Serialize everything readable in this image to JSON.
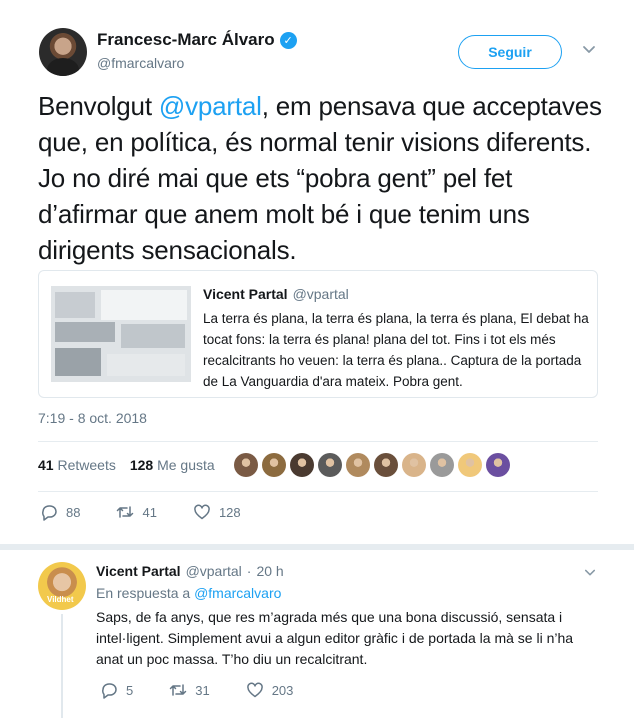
{
  "tweet": {
    "author_name": "Francesc-Marc Álvaro",
    "author_handle": "@fmarcalvaro",
    "follow_label": "Seguir",
    "text_prefix": "Benvolgut ",
    "text_mention": "@vpartal",
    "text_body": ", em pensava que acceptaves que, en política, és normal tenir visions diferents. Jo no diré mai que ets “pobra gent” pel fet d’afirmar que anem molt bé i que tenim uns dirigents sensacionals.",
    "timestamp": "7:19 - 8 oct. 2018",
    "retweets_count": "41",
    "retweets_label": "Retweets",
    "likes_count": "128",
    "likes_label": "Me gusta",
    "actions": {
      "replies": "88",
      "retweets": "41",
      "likes": "128"
    }
  },
  "quoted": {
    "name": "Vicent Partal",
    "handle": "@vpartal",
    "text": "La terra és plana, la terra és plana, la terra és plana, El debat ha tocat fons: la terra és plana! plana del tot. Fins i tot els més recalcitrants ho veuen: la terra és plana.. Captura de la portada de La Vanguardia d'ara mateix. Pobra gent."
  },
  "reply": {
    "name": "Vicent Partal",
    "handle": "@vpartal",
    "sep": "·",
    "time": "20 h",
    "in_reply_label": "En respuesta a",
    "in_reply_to": "@fmarcalvaro",
    "text": "Saps, de fa anys, que res m’agrada més que una bona discussió, sensata i intel·ligent. Simplement avui a algun editor gràfic i de portada la mà se li n’ha anat un poc massa. T’ho diu un recalcitrant.",
    "avatar_label": "Vildhet",
    "actions": {
      "replies": "5",
      "retweets": "31",
      "likes": "203"
    }
  },
  "colors": {
    "accent": "#1da1f2",
    "text": "#14171a",
    "muted": "#657786",
    "liker_avatars": [
      "#7a5a44",
      "#8c6b3f",
      "#4a3a30",
      "#5b5b5b",
      "#b08a5e",
      "#6a4f3b",
      "#d9b48a",
      "#9a9a9a",
      "#f0c87a",
      "#6b4fa0"
    ]
  }
}
